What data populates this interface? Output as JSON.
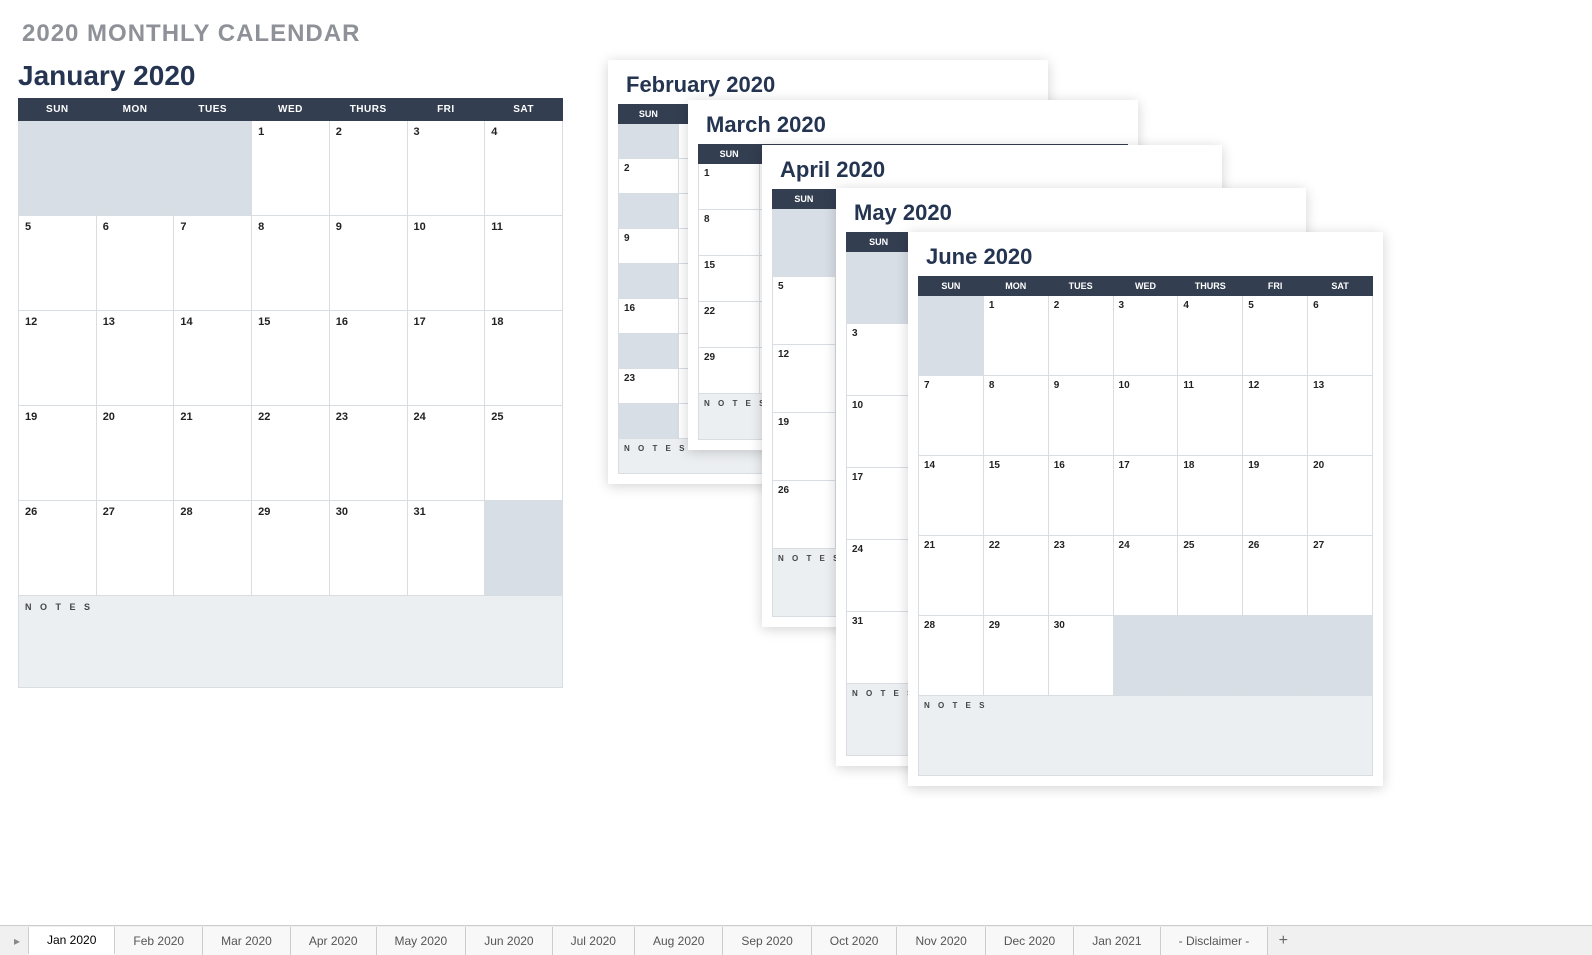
{
  "page_title": "2020 MONTHLY CALENDAR",
  "dow_full": [
    "SUN",
    "MON",
    "TUES",
    "WED",
    "THURS",
    "FRI",
    "SAT"
  ],
  "notes_label": "N O T E S",
  "jan": {
    "title": "January 2020",
    "grid": [
      [
        "",
        "",
        "",
        "1",
        "2",
        "3",
        "4"
      ],
      [
        "5",
        "6",
        "7",
        "8",
        "9",
        "10",
        "11"
      ],
      [
        "12",
        "13",
        "14",
        "15",
        "16",
        "17",
        "18"
      ],
      [
        "19",
        "20",
        "21",
        "22",
        "23",
        "24",
        "25"
      ],
      [
        "26",
        "27",
        "28",
        "29",
        "30",
        "31",
        ""
      ]
    ]
  },
  "feb": {
    "title": "February 2020",
    "grid_first_col": [
      "",
      "2",
      "",
      "9",
      "",
      "16",
      "",
      "23",
      ""
    ]
  },
  "mar": {
    "title": "March 2020",
    "grid_first_col": [
      "1",
      "8",
      "15",
      "22",
      "29"
    ]
  },
  "apr": {
    "title": "April 2020",
    "grid_first_col": [
      "",
      "5",
      "12",
      "19",
      "26"
    ]
  },
  "may": {
    "title": "May 2020",
    "grid_first_col": [
      "",
      "3",
      "10",
      "17",
      "24",
      "31"
    ]
  },
  "jun": {
    "title": "June 2020",
    "grid": [
      [
        "",
        "1",
        "2",
        "3",
        "4",
        "5",
        "6"
      ],
      [
        "7",
        "8",
        "9",
        "10",
        "11",
        "12",
        "13"
      ],
      [
        "14",
        "15",
        "16",
        "17",
        "18",
        "19",
        "20"
      ],
      [
        "21",
        "22",
        "23",
        "24",
        "25",
        "26",
        "27"
      ],
      [
        "28",
        "29",
        "30",
        "",
        "",
        "",
        ""
      ]
    ]
  },
  "tabs": {
    "items": [
      "Jan 2020",
      "Feb 2020",
      "Mar 2020",
      "Apr 2020",
      "May 2020",
      "Jun 2020",
      "Jul 2020",
      "Aug 2020",
      "Sep 2020",
      "Oct 2020",
      "Nov 2020",
      "Dec 2020",
      "Jan 2021",
      "- Disclaimer -"
    ],
    "active": "Jan 2020"
  }
}
